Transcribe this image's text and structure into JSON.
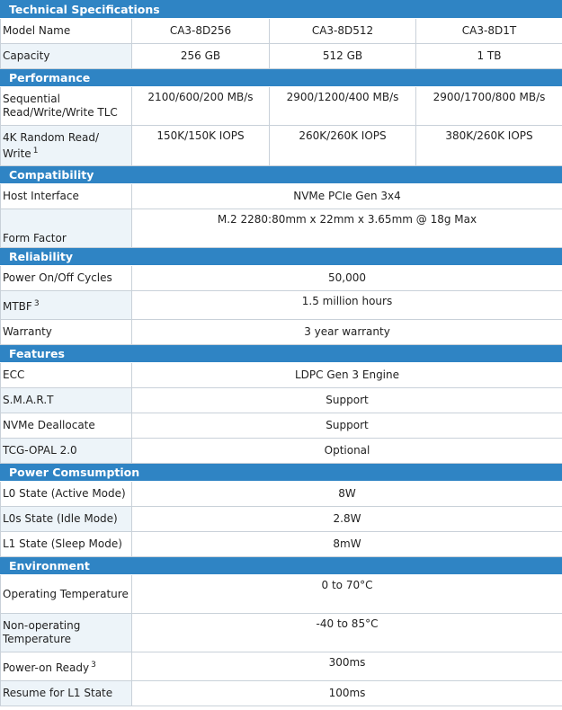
{
  "sections": {
    "technical": "Technical Specifications",
    "performance": "Performance",
    "compatibility": "Compatibility",
    "reliability": "Reliability",
    "features": "Features",
    "power": "Power Comsumption",
    "environment": "Environment"
  },
  "rows": {
    "model_name": {
      "label": "Model Name",
      "values": [
        "CA3-8D256",
        "CA3-8D512",
        "CA3-8D1T"
      ]
    },
    "capacity": {
      "label": "Capacity",
      "values": [
        "256 GB",
        "512 GB",
        "1 TB"
      ]
    },
    "sequential": {
      "label": "Sequential Read/Write/Write TLC",
      "values": [
        "2100/600/200 MB/s",
        "2900/1200/400 MB/s",
        "2900/1700/800 MB/s"
      ]
    },
    "random": {
      "label": "4K Random Read/ Write",
      "sup": "1",
      "values": [
        "150K/150K IOPS",
        "260K/260K IOPS",
        "380K/260K IOPS"
      ]
    },
    "host_interface": {
      "label": "Host Interface",
      "value": "NVMe PCIe Gen 3x4"
    },
    "form_factor": {
      "label": "Form Factor",
      "value": "M.2 2280:80mm x 22mm x 3.65mm @ 18g Max"
    },
    "power_cycles": {
      "label": "Power On/Off Cycles",
      "value": "50,000"
    },
    "mtbf": {
      "label": "MTBF",
      "sup": "3",
      "value": "1.5 million hours"
    },
    "warranty": {
      "label": "Warranty",
      "value": "3 year warranty"
    },
    "ecc": {
      "label": "ECC",
      "value": "LDPC Gen 3 Engine"
    },
    "smart": {
      "label": "S.M.A.R.T",
      "value": "Support"
    },
    "deallocate": {
      "label": "NVMe Deallocate",
      "value": "Support"
    },
    "tcg": {
      "label": "TCG-OPAL 2.0",
      "value": "Optional"
    },
    "l0": {
      "label": "L0 State (Active Mode)",
      "value": "8W"
    },
    "l0s": {
      "label": "L0s State (Idle Mode)",
      "value": "2.8W"
    },
    "l1": {
      "label": "L1 State (Sleep Mode)",
      "value": "8mW"
    },
    "op_temp": {
      "label": "Operating Temperature",
      "value": "0 to 70°C"
    },
    "nonop_temp": {
      "label": "Non-operating Temperature",
      "value": "-40 to 85°C"
    },
    "power_ready": {
      "label": "Power-on Ready",
      "sup": "3",
      "value": "300ms"
    },
    "resume_l1": {
      "label": "Resume for L1 State",
      "value": "100ms"
    }
  }
}
